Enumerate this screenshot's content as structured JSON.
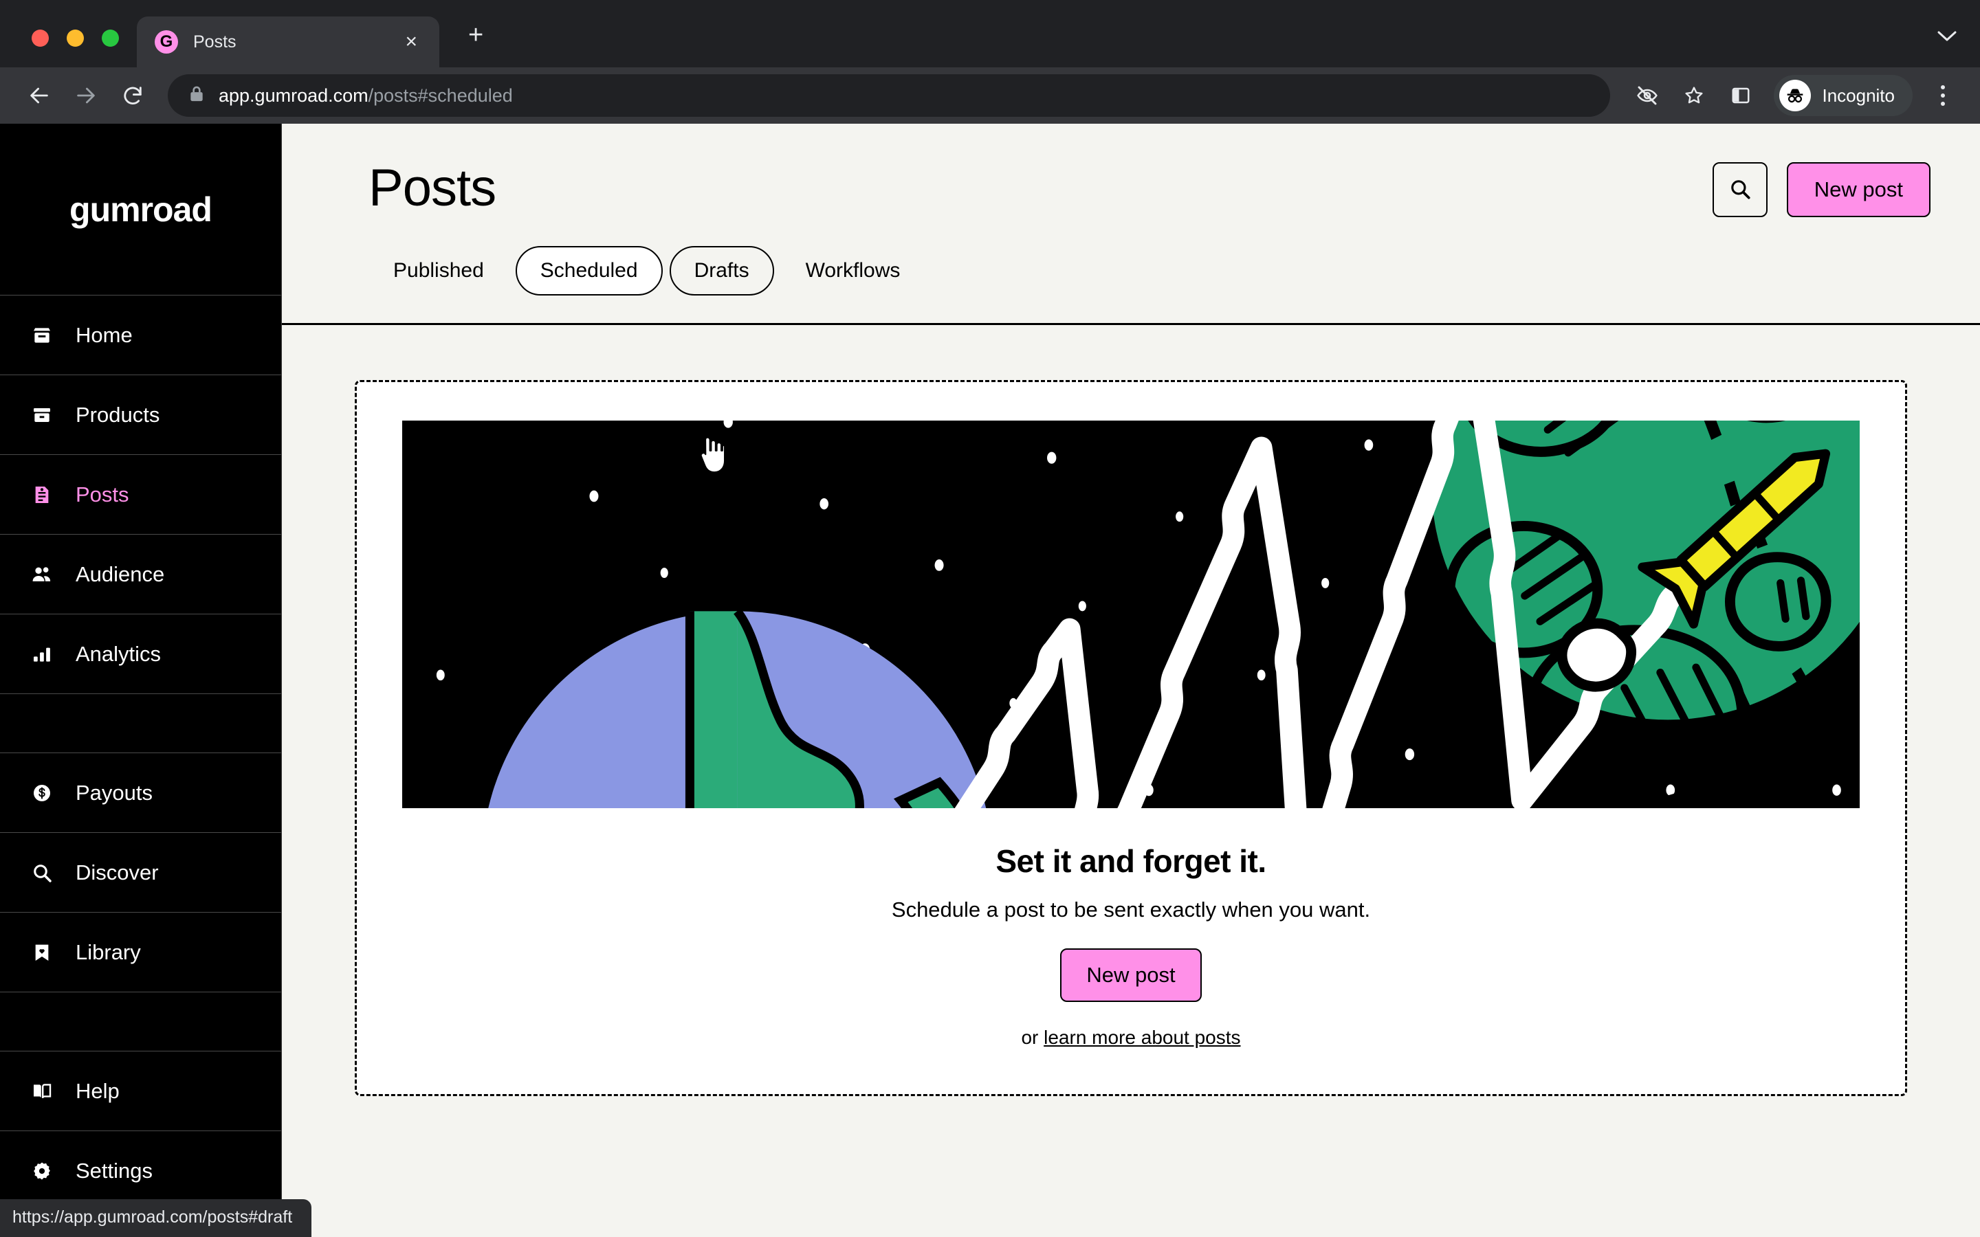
{
  "browser": {
    "tab": {
      "title": "Posts",
      "favicon_letter": "G",
      "favicon_name": "gumroad-favicon"
    },
    "new_tab_glyph": "+",
    "close_glyph": "×",
    "tab_list_glyph": "⌄",
    "url": {
      "host": "app.gumroad.com",
      "path": "/posts#scheduled",
      "full": "app.gumroad.com/posts#scheduled"
    },
    "profile": {
      "label": "Incognito"
    },
    "status_bubble": "https://app.gumroad.com/posts#draft",
    "icons": {
      "back": "back-arrow-icon",
      "forward": "forward-arrow-icon",
      "reload": "reload-icon",
      "lock": "lock-icon",
      "tracking_protection": "eye-slash-icon",
      "bookmark": "star-icon",
      "side_panel": "side-panel-icon",
      "menu": "three-dot-menu-icon"
    }
  },
  "sidebar": {
    "logo": "gumroad",
    "items": [
      {
        "label": "Home",
        "icon": "storefront-icon",
        "active": false
      },
      {
        "label": "Products",
        "icon": "archive-box-icon",
        "active": false
      },
      {
        "label": "Posts",
        "icon": "document-icon",
        "active": true
      },
      {
        "label": "Audience",
        "icon": "people-icon",
        "active": false
      },
      {
        "label": "Analytics",
        "icon": "bar-chart-icon",
        "active": false
      },
      {
        "label": "",
        "icon": "",
        "active": false,
        "spacer": true
      },
      {
        "label": "Payouts",
        "icon": "dollar-coin-icon",
        "active": false
      },
      {
        "label": "Discover",
        "icon": "magnifier-icon",
        "active": false
      },
      {
        "label": "Library",
        "icon": "bookmark-heart-icon",
        "active": false
      },
      {
        "label": "",
        "icon": "",
        "active": false,
        "spacer": true
      },
      {
        "label": "Help",
        "icon": "open-book-icon",
        "active": false
      },
      {
        "label": "Settings",
        "icon": "gear-icon",
        "active": false
      }
    ]
  },
  "header": {
    "title": "Posts",
    "search_icon": "search-icon",
    "new_post_label": "New post",
    "tabs": [
      {
        "label": "Published",
        "state": "default"
      },
      {
        "label": "Scheduled",
        "state": "active"
      },
      {
        "label": "Drafts",
        "state": "hover"
      },
      {
        "label": "Workflows",
        "state": "default"
      }
    ]
  },
  "empty_state": {
    "illustration": "rocket-to-planet-illustration",
    "title": "Set it and forget it.",
    "subtitle": "Schedule a post to be sent exactly when you want.",
    "cta_label": "New post",
    "or_text": "or ",
    "link_text": "learn more about posts"
  },
  "colors": {
    "accent_pink": "#ff90e8",
    "page_bg": "#f4f4f0",
    "sidebar_bg": "#000000",
    "card_bg": "#ffffff",
    "illustration_bg": "#000000",
    "earth_blue": "#8a97e3",
    "land_teal": "#2bab79",
    "planet_teal": "#1ea06e",
    "rocket_yellow": "#f2ea21",
    "chrome_dark": "#202124",
    "chrome_toolbar": "#35363a"
  }
}
